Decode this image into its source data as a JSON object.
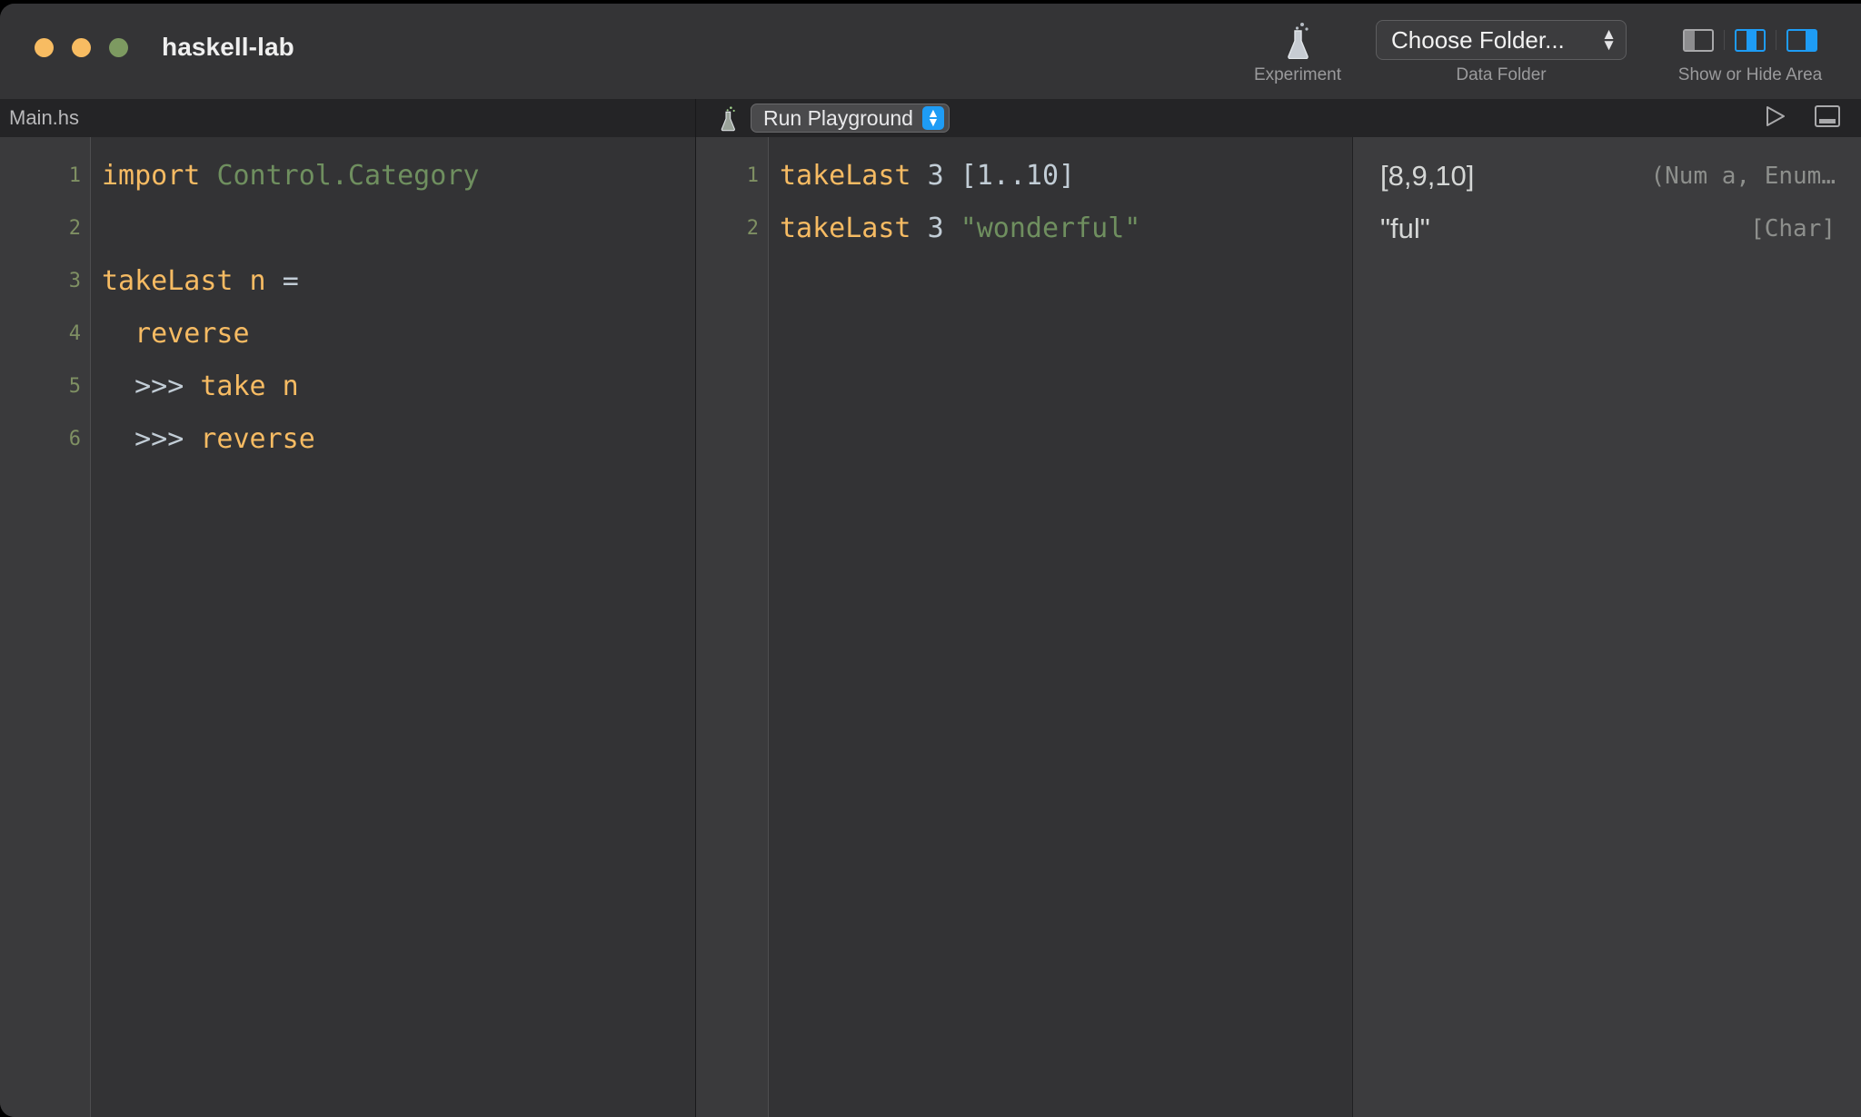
{
  "window": {
    "title": "haskell-lab",
    "traffic_lights": [
      {
        "name": "close",
        "color": "#f8bc62"
      },
      {
        "name": "minimize",
        "color": "#f8bc62"
      },
      {
        "name": "zoom",
        "color": "#7d9a61"
      }
    ]
  },
  "toolbar": {
    "experiment": {
      "label": "Experiment",
      "icon": "flask-icon"
    },
    "data_folder": {
      "label": "Data Folder",
      "select_value": "Choose Folder...",
      "stepper_icon": "chevron-up-down-icon"
    },
    "show_hide_area": {
      "label": "Show or Hide Area",
      "panels": [
        {
          "name": "left-panel",
          "active": false
        },
        {
          "name": "middle-panel",
          "active": true
        },
        {
          "name": "right-panel",
          "active": true
        }
      ]
    }
  },
  "tabbar": {
    "filename": "Main.hs",
    "flask_icon": "flask-icon",
    "run_playground": {
      "label": "Run Playground",
      "stepper_icon": "chevron-up-down-icon"
    },
    "run_icon": "play-triangle-icon",
    "console_icon": "console-panel-icon"
  },
  "editor": {
    "line_numbers": [
      "1",
      "2",
      "3",
      "4",
      "5",
      "6"
    ],
    "lines": [
      [
        {
          "t": "import",
          "c": "kw"
        },
        {
          "t": " ",
          "c": "plain"
        },
        {
          "t": "Control.Category",
          "c": "type"
        }
      ],
      [],
      [
        {
          "t": "takeLast n ",
          "c": "fn"
        },
        {
          "t": "=",
          "c": "op"
        }
      ],
      [
        {
          "t": "  reverse",
          "c": "fn"
        }
      ],
      [
        {
          "t": "  ",
          "c": "plain"
        },
        {
          "t": ">>>",
          "c": "op"
        },
        {
          "t": " take n",
          "c": "fn"
        }
      ],
      [
        {
          "t": "  ",
          "c": "plain"
        },
        {
          "t": ">>>",
          "c": "op"
        },
        {
          "t": " reverse",
          "c": "fn"
        }
      ]
    ]
  },
  "playground": {
    "line_numbers": [
      "1",
      "2"
    ],
    "lines": [
      [
        {
          "t": "takeLast",
          "c": "fn"
        },
        {
          "t": " ",
          "c": "plain"
        },
        {
          "t": "3",
          "c": "num"
        },
        {
          "t": " ",
          "c": "plain"
        },
        {
          "t": "[1..10]",
          "c": "punct"
        }
      ],
      [
        {
          "t": "takeLast",
          "c": "fn"
        },
        {
          "t": " ",
          "c": "plain"
        },
        {
          "t": "3",
          "c": "num"
        },
        {
          "t": " ",
          "c": "plain"
        },
        {
          "t": "\"wonderful\"",
          "c": "str"
        }
      ]
    ]
  },
  "results": {
    "rows": [
      {
        "value": "[8,9,10]",
        "type": "(Num a, Enum…"
      },
      {
        "value": "\"ful\"",
        "type": "[Char]"
      }
    ]
  }
}
